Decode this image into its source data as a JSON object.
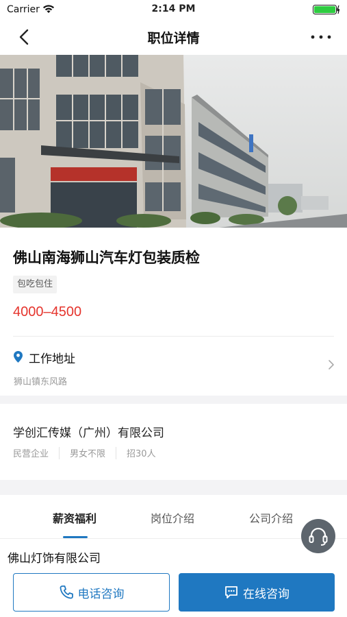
{
  "status_bar": {
    "carrier": "Carrier",
    "time": "2:14 PM"
  },
  "nav": {
    "title": "职位详情"
  },
  "job": {
    "title": "佛山南海狮山汽车灯包装质检",
    "tag": "包吃包住",
    "salary": "4000–4500",
    "address_label": "工作地址",
    "address": "狮山镇东风路"
  },
  "company": {
    "name": "学创汇传媒（广州）有限公司",
    "type": "民营企业",
    "gender": "男女不限",
    "headcount": "招30人"
  },
  "tabs": [
    {
      "label": "薪资福利",
      "active": true
    },
    {
      "label": "岗位介绍",
      "active": false
    },
    {
      "label": "公司介绍",
      "active": false
    }
  ],
  "section": {
    "title": "佛山灯饰有限公司"
  },
  "actions": {
    "call_label": "电话咨询",
    "chat_label": "在线咨询"
  },
  "colors": {
    "accent": "#1f78c1",
    "salary": "#e5342d"
  },
  "icons": [
    "wifi-icon",
    "battery-icon",
    "back-icon",
    "more-icon",
    "location-pin-icon",
    "chevron-right-icon",
    "headset-icon",
    "phone-icon",
    "chat-icon"
  ]
}
